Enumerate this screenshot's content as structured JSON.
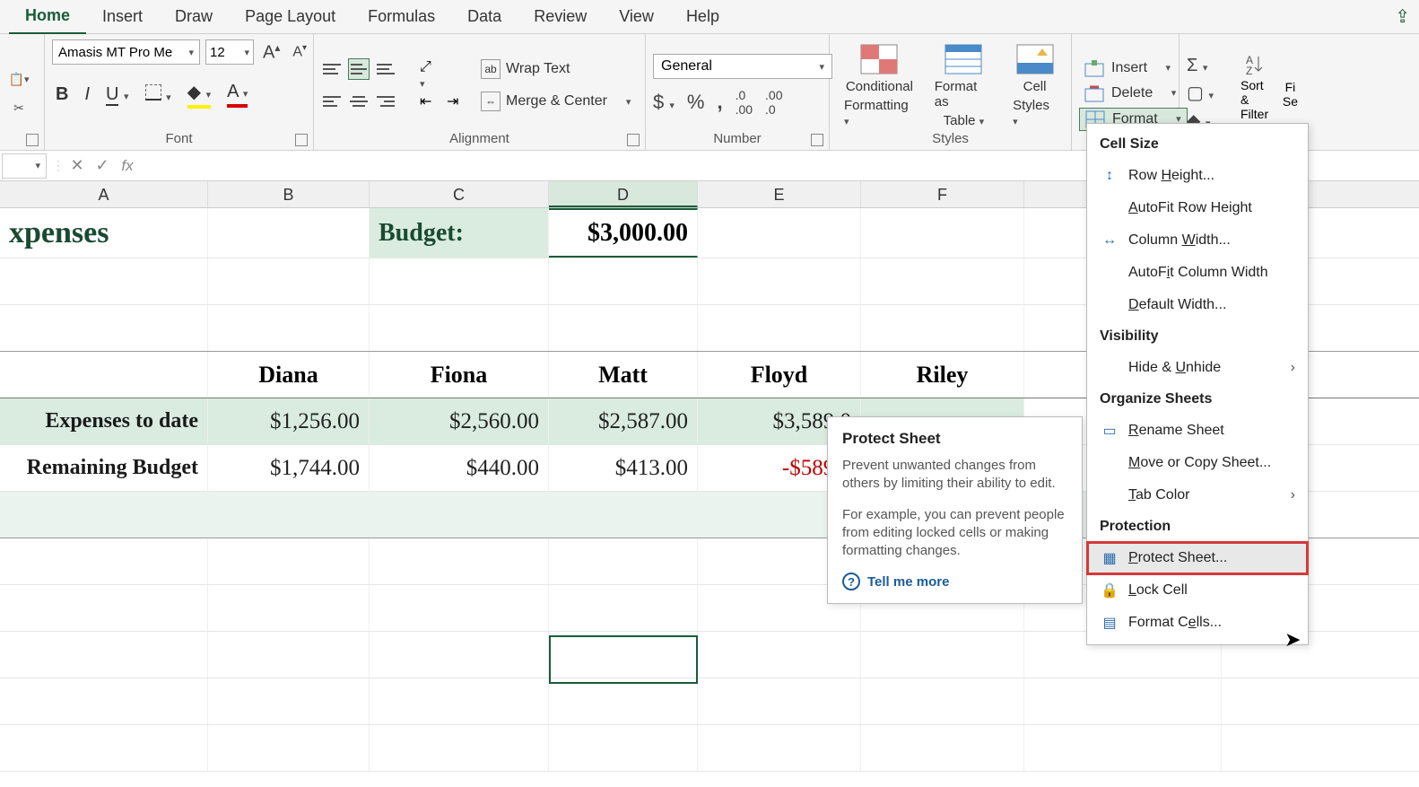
{
  "tabs": {
    "home": "Home",
    "insert": "Insert",
    "draw": "Draw",
    "page_layout": "Page Layout",
    "formulas": "Formulas",
    "data": "Data",
    "review": "Review",
    "view": "View",
    "help": "Help"
  },
  "font": {
    "name": "Amasis MT Pro Me",
    "size": "12"
  },
  "groups": {
    "font": "Font",
    "alignment": "Alignment",
    "number": "Number",
    "styles": "Styles"
  },
  "wrap_text": "Wrap Text",
  "merge_center": "Merge & Center",
  "number_format": "General",
  "styles_btns": {
    "cond": "Conditional",
    "cond2": "Formatting",
    "fat": "Format as",
    "fat2": "Table",
    "cell": "Cell",
    "cell2": "Styles"
  },
  "cells": {
    "insert": "Insert",
    "delete": "Delete",
    "format": "Format"
  },
  "editing": {
    "sort": "Sort &",
    "filter": "Filter",
    "fi": "Fi",
    "se": "Se"
  },
  "sheet": {
    "columns": [
      "A",
      "B",
      "C",
      "D",
      "E",
      "F"
    ],
    "title": "xpenses",
    "budget_label": "Budget:",
    "budget_value": "$3,000.00",
    "names": {
      "b": "Diana",
      "c": "Fiona",
      "d": "Matt",
      "e": "Floyd",
      "f": "Riley"
    },
    "row1": {
      "label": "Expenses to date",
      "b": "$1,256.00",
      "c": "$2,560.00",
      "d": "$2,587.00",
      "e": "$3,589.0"
    },
    "row2": {
      "label": "Remaining Budget",
      "b": "$1,744.00",
      "c": "$440.00",
      "d": "$413.00",
      "e": "-$589.0"
    }
  },
  "tooltip": {
    "title": "Protect Sheet",
    "p1": "Prevent unwanted changes from others by limiting their ability to edit.",
    "p2": "For example, you can prevent people from editing locked cells or making formatting changes.",
    "tellmore": "Tell me more"
  },
  "menu": {
    "cellsize": "Cell Size",
    "rowheight": "Row Height...",
    "autofitrow": "AutoFit Row Height",
    "colwidth": "Column Width...",
    "autofitcol": "AutoFit Column Width",
    "defwidth": "Default Width...",
    "visibility": "Visibility",
    "hideunhide": "Hide & Unhide",
    "organize": "Organize Sheets",
    "rename": "Rename Sheet",
    "movecopy": "Move or Copy Sheet...",
    "tabcolor": "Tab Color",
    "protection": "Protection",
    "protectsheet": "Protect Sheet...",
    "lockcell": "Lock Cell",
    "formatcells": "Format Cells..."
  }
}
